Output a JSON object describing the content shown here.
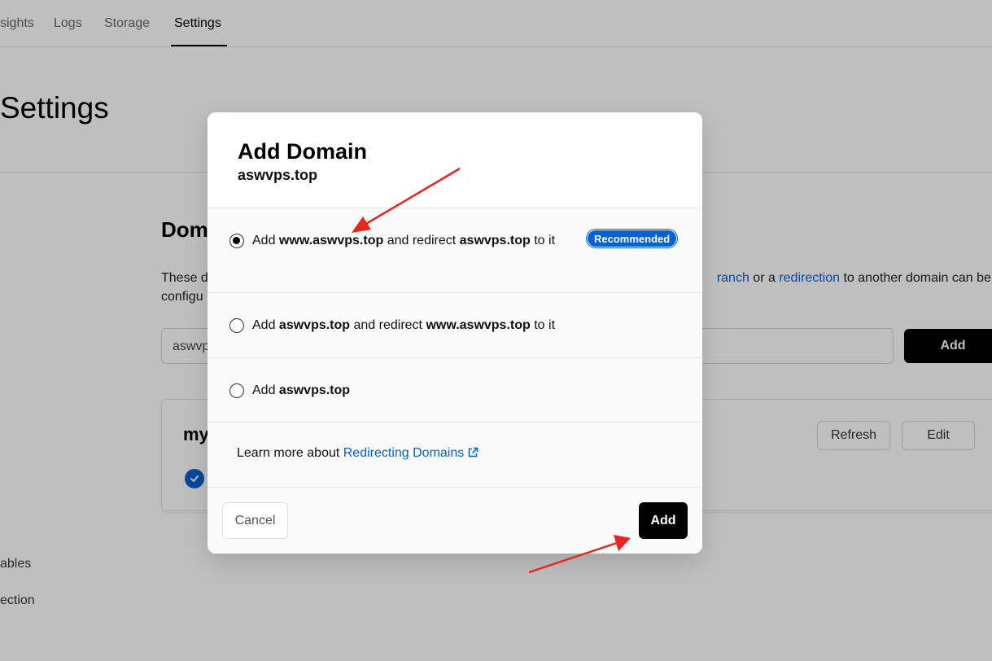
{
  "nav": {
    "tabs": [
      {
        "label": "sights"
      },
      {
        "label": "Logs"
      },
      {
        "label": "Storage"
      },
      {
        "label": "Settings"
      }
    ]
  },
  "page": {
    "title": "Settings"
  },
  "domains_section": {
    "heading": "Dom",
    "description_start": "These d",
    "description_line2": "configu",
    "description_branch_link": "ranch",
    "description_or": " or a ",
    "description_redirection_link": "redirection",
    "description_end": " to another domain can be",
    "input_value": "aswvp",
    "add_label": "Add"
  },
  "domain_card": {
    "name": "my",
    "refresh_label": "Refresh",
    "edit_label": "Edit"
  },
  "sidebar": {
    "items": [
      {
        "label": "ables"
      },
      {
        "label": "ection"
      }
    ]
  },
  "modal": {
    "title": "Add Domain",
    "subtitle": "aswvps.top",
    "options": [
      {
        "prefix": "Add ",
        "domain_a": "www.aswvps.top",
        "middle": " and redirect ",
        "domain_b": "aswvps.top",
        "suffix": " to it",
        "badge": "Recommended",
        "checked": true
      },
      {
        "prefix": "Add ",
        "domain_a": "aswvps.top",
        "middle": " and redirect ",
        "domain_b": "www.aswvps.top",
        "suffix": " to it",
        "checked": false
      },
      {
        "prefix": "Add ",
        "domain_a": "aswvps.top",
        "checked": false
      }
    ],
    "learn_more_text": "Learn more about ",
    "learn_more_link": "Redirecting Domains",
    "cancel_label": "Cancel",
    "add_label": "Add"
  },
  "colors": {
    "accent": "#0761d1",
    "annotation_arrow": "#e8261d"
  },
  "icons": [
    "check-icon",
    "external-link-icon",
    "radio-checked-icon",
    "radio-unchecked-icon",
    "annotation-arrow"
  ]
}
